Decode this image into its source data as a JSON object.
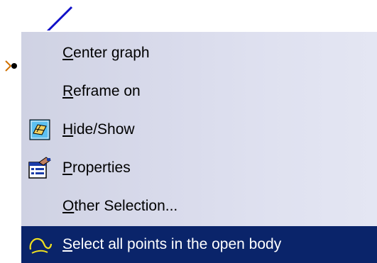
{
  "menu": {
    "items": [
      {
        "mnemonic": "C",
        "rest": "enter graph",
        "icon": null,
        "selected": false
      },
      {
        "mnemonic": "R",
        "rest": "eframe on",
        "icon": null,
        "selected": false
      },
      {
        "mnemonic": "H",
        "rest": "ide/Show",
        "icon": "hide-show-icon",
        "selected": false
      },
      {
        "mnemonic": "P",
        "rest": "roperties",
        "icon": "properties-icon",
        "selected": false
      },
      {
        "mnemonic": "O",
        "rest": "ther Selection...",
        "icon": null,
        "selected": false
      },
      {
        "mnemonic": "S",
        "rest": "elect all points in the open body",
        "icon": "curve-icon",
        "selected": true
      }
    ]
  },
  "colors": {
    "menu_bg": "#d7d9ea",
    "selection_bg": "#0a246a",
    "selection_text": "#ffffff",
    "line_blue": "#1010c8",
    "node_orange": "#d07000"
  }
}
